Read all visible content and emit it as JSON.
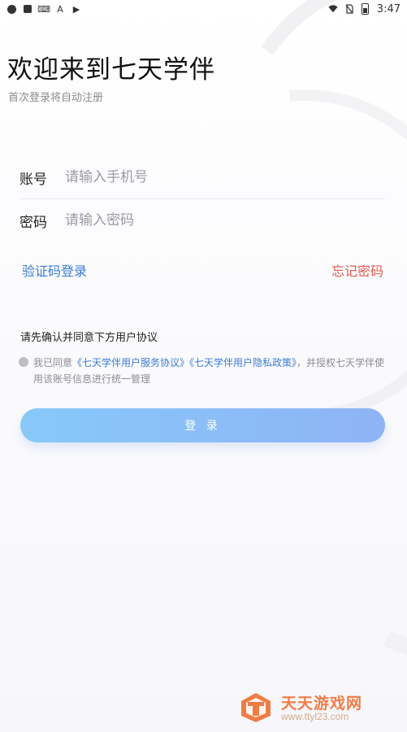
{
  "status_bar": {
    "time": "3:47",
    "left_icons": [
      "app-icon",
      "notification-icon",
      "keyboard-icon",
      "font-icon",
      "play-icon"
    ],
    "right_icons": [
      "wifi-icon",
      "no-sim-icon",
      "battery-icon"
    ]
  },
  "header": {
    "title": "欢迎来到七天学伴",
    "subtitle": "首次登录将自动注册"
  },
  "form": {
    "account_label": "账号",
    "account_placeholder": "请输入手机号",
    "password_label": "密码",
    "password_placeholder": "请输入密码"
  },
  "links": {
    "code_login": "验证码登录",
    "forgot_password": "忘记密码"
  },
  "agreement": {
    "heading": "请先确认并同意下方用户协议",
    "prefix": "我已同意",
    "service_agreement": "《七天学伴用户服务协议》",
    "privacy_policy": "《七天学伴用户隐私政策》",
    "suffix": "，并授权七天学伴使用该账号信息进行统一管理"
  },
  "login_button": {
    "label": "登 录"
  },
  "watermark": {
    "title": "天天游戏网",
    "url": "www.ttyl23.com"
  },
  "colors": {
    "accent_blue": "#3a7bd5",
    "accent_red": "#e05a4f",
    "button_gradient_start": "#87c9f8",
    "button_gradient_end": "#8fb3f6",
    "watermark_orange": "#f07c45"
  }
}
